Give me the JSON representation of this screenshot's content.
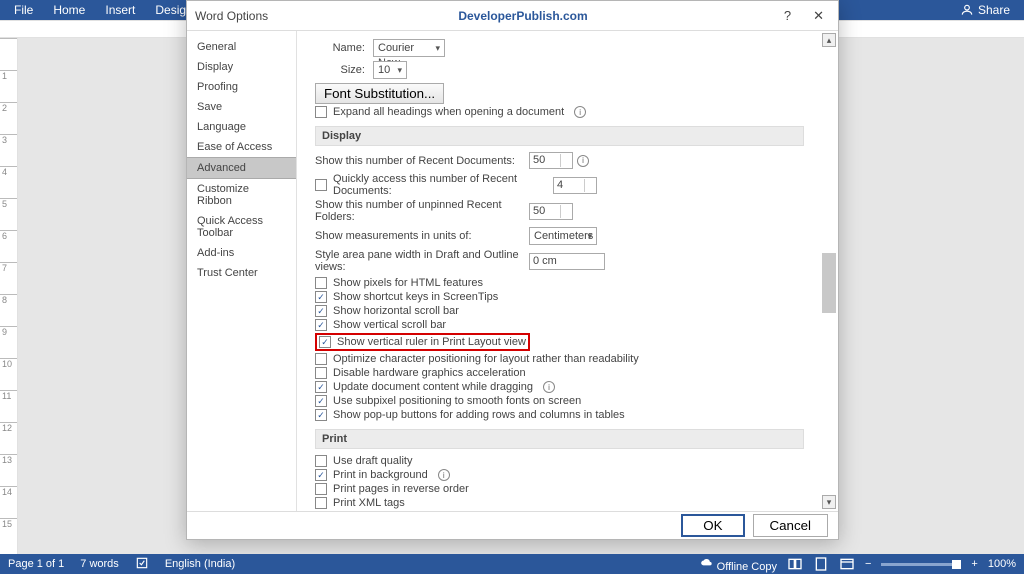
{
  "ribbon": {
    "tabs": [
      "File",
      "Home",
      "Insert",
      "Design"
    ],
    "share": "Share"
  },
  "dialog": {
    "title": "Word Options",
    "site_link": "DeveloperPublish.com",
    "categories": [
      "General",
      "Display",
      "Proofing",
      "Save",
      "Language",
      "Ease of Access",
      "Advanced",
      "Customize Ribbon",
      "Quick Access Toolbar",
      "Add-ins",
      "Trust Center"
    ],
    "active_category": "Advanced",
    "name_label": "Name:",
    "name_value": "Courier New",
    "size_label": "Size:",
    "size_value": "10",
    "font_sub_btn": "Font Substitution...",
    "expand_headings": "Expand all headings when opening a document",
    "section_display": "Display",
    "recent_docs_label": "Show this number of Recent Documents:",
    "recent_docs_value": "50",
    "quick_access_label": "Quickly access this number of Recent Documents:",
    "quick_access_value": "4",
    "recent_folders_label": "Show this number of unpinned Recent Folders:",
    "recent_folders_value": "50",
    "units_label": "Show measurements in units of:",
    "units_value": "Centimeters",
    "style_area_label": "Style area pane width in Draft and Outline views:",
    "style_area_value": "0 cm",
    "opt_pixels": "Show pixels for HTML features",
    "opt_shortcut": "Show shortcut keys in ScreenTips",
    "opt_hscroll": "Show horizontal scroll bar",
    "opt_vscroll": "Show vertical scroll bar",
    "opt_vruler": "Show vertical ruler in Print Layout view",
    "opt_optimize": "Optimize character positioning for layout rather than readability",
    "opt_hardware": "Disable hardware graphics acceleration",
    "opt_dragging": "Update document content while dragging",
    "opt_subpixel": "Use subpixel positioning to smooth fonts on screen",
    "opt_popup": "Show pop-up buttons for adding rows and columns in tables",
    "section_print": "Print",
    "opt_draft": "Use draft quality",
    "opt_background": "Print in background",
    "opt_reverse": "Print pages in reverse order",
    "opt_xml": "Print XML tags",
    "ok": "OK",
    "cancel": "Cancel"
  },
  "statusbar": {
    "page": "Page 1 of 1",
    "words": "7 words",
    "lang": "English (India)",
    "offline": "Offline Copy",
    "zoom": "100%"
  }
}
